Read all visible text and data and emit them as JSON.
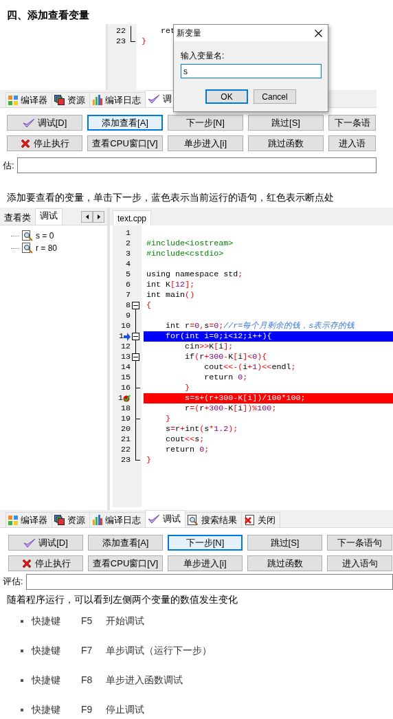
{
  "heading": "四、添加查看变量",
  "shot1": {
    "editor": {
      "lines": [
        {
          "number": "22",
          "code": "    ret",
          "kind": "guide",
          "current": false,
          "breakpoint": false
        },
        {
          "number": "23",
          "code": "}",
          "kind": "last",
          "current": false,
          "breakpoint": false
        }
      ]
    },
    "dialog": {
      "title": "新变量",
      "label": "输入变量名:",
      "value": "s",
      "buttons": [
        {
          "label": "OK",
          "default": true
        },
        {
          "label": "Cancel",
          "default": false
        }
      ]
    },
    "tabs": [
      {
        "label": "编译器",
        "kind": "grid",
        "selected": false
      },
      {
        "label": "资源",
        "kind": "squares",
        "selected": false
      },
      {
        "label": "编译日志",
        "kind": "bars",
        "selected": false
      },
      {
        "label": "调",
        "kind": "check",
        "selected": true
      }
    ],
    "buttons": [
      {
        "label": "调试[D]",
        "kind": "check",
        "focused": false
      },
      {
        "label": "添加查看[A]",
        "kind": "plain",
        "focused": true
      },
      {
        "label": "下一步[N]",
        "kind": "plain",
        "focused": false
      },
      {
        "label": "跳过[S]",
        "kind": "plain",
        "focused": false
      },
      {
        "label": "下一条语",
        "kind": "plain",
        "focused": false
      },
      {
        "label": "停止执行",
        "kind": "cross",
        "focused": false
      },
      {
        "label": "查看CPU窗口[V]",
        "kind": "plain",
        "focused": false
      },
      {
        "label": "单步进入[i]",
        "kind": "plain",
        "focused": false
      },
      {
        "label": "跳过函数",
        "kind": "plain",
        "focused": false
      },
      {
        "label": "进入语",
        "kind": "plain",
        "focused": false
      }
    ],
    "eval_label": "估:"
  },
  "caption_1": "添加要查看的变量，单击下一步，蓝色表示当前运行的语句，红色表示断点处",
  "shot2": {
    "side_tabs": [
      {
        "label": "查看类",
        "selected": false
      },
      {
        "label": "调试",
        "selected": true
      }
    ],
    "watches": [
      {
        "text": "s = 0"
      },
      {
        "text": "r = 80"
      }
    ],
    "editor": {
      "file_tab": "text.cpp",
      "lines": [
        {
          "number": "1",
          "kind": "plain",
          "current": false,
          "breakpoint": false
        },
        {
          "number": "2",
          "code": "#include<iostream>",
          "kind": "plain",
          "current": false,
          "breakpoint": false
        },
        {
          "number": "3",
          "code": "#include<cstdio>",
          "kind": "plain",
          "current": false,
          "breakpoint": false
        },
        {
          "number": "4",
          "kind": "plain",
          "current": false,
          "breakpoint": false
        },
        {
          "number": "5",
          "code": "using namespace std;",
          "kind": "plain",
          "current": false,
          "breakpoint": false
        },
        {
          "number": "6",
          "code": "int K[12];",
          "kind": "plain",
          "current": false,
          "breakpoint": false
        },
        {
          "number": "7",
          "code": "int main()",
          "kind": "plain",
          "current": false,
          "breakpoint": false
        },
        {
          "number": "8",
          "code": "{",
          "kind": "collapse",
          "current": false,
          "breakpoint": false
        },
        {
          "number": "9",
          "kind": "guide",
          "current": false,
          "breakpoint": false
        },
        {
          "number": "10",
          "code": "    int r=0,s=0;//r=每个月剩余的钱，s表示存的钱",
          "kind": "guide",
          "current": false,
          "breakpoint": false
        },
        {
          "number": "1",
          "code": "    for(int i=0;i<12;i++){",
          "kind": "collapse",
          "current": true,
          "breakpoint": false
        },
        {
          "number": "12",
          "code": "        cin>>K[i];",
          "kind": "guide",
          "current": false,
          "breakpoint": false
        },
        {
          "number": "13",
          "code": "        if(r+300-K[i]<0){",
          "kind": "collapse",
          "current": false,
          "breakpoint": false
        },
        {
          "number": "14",
          "code": "            cout<<-(i+1)<<endl;",
          "kind": "guide",
          "current": false,
          "breakpoint": false
        },
        {
          "number": "15",
          "code": "            return 0;",
          "kind": "guide",
          "current": false,
          "breakpoint": false
        },
        {
          "number": "16",
          "code": "        }",
          "kind": "end",
          "current": false,
          "breakpoint": false
        },
        {
          "number": "1",
          "code": "        s=s+(r+300-K[i])/100*100;",
          "kind": "guide",
          "current": false,
          "breakpoint": true
        },
        {
          "number": "18",
          "code": "        r=(r+300-K[i])%100;",
          "kind": "guide",
          "current": false,
          "breakpoint": false
        },
        {
          "number": "19",
          "code": "    }",
          "kind": "end",
          "current": false,
          "breakpoint": false
        },
        {
          "number": "20",
          "code": "    s=r+int(s*1.2);",
          "kind": "guide",
          "current": false,
          "breakpoint": false
        },
        {
          "number": "21",
          "code": "    cout<<s;",
          "kind": "guide",
          "current": false,
          "breakpoint": false
        },
        {
          "number": "22",
          "code": "    return 0;",
          "kind": "guide",
          "current": false,
          "breakpoint": false
        },
        {
          "number": "23",
          "code": "}",
          "kind": "last",
          "current": false,
          "breakpoint": false
        }
      ]
    },
    "tabs": [
      {
        "label": "编译器",
        "kind": "grid",
        "selected": false
      },
      {
        "label": "资源",
        "kind": "squares",
        "selected": false
      },
      {
        "label": "编译日志",
        "kind": "bars",
        "selected": false
      },
      {
        "label": "调试",
        "kind": "check",
        "selected": true
      },
      {
        "label": "搜索结果",
        "kind": "search",
        "selected": false
      },
      {
        "label": "关闭",
        "kind": "close",
        "selected": false
      }
    ],
    "buttons": [
      {
        "label": "调试[D]",
        "kind": "check",
        "focused": false
      },
      {
        "label": "添加查看[A]",
        "kind": "plain",
        "focused": false
      },
      {
        "label": "下一步[N]",
        "kind": "plain",
        "focused": true
      },
      {
        "label": "跳过[S]",
        "kind": "plain",
        "focused": false
      },
      {
        "label": "下一条语句",
        "kind": "plain",
        "focused": false
      },
      {
        "label": "停止执行",
        "kind": "cross",
        "focused": false
      },
      {
        "label": "查看CPU窗口[V]",
        "kind": "plain",
        "focused": false
      },
      {
        "label": "单步进入[i]",
        "kind": "plain",
        "focused": false
      },
      {
        "label": "跳过函数",
        "kind": "plain",
        "focused": false
      },
      {
        "label": "进入语句",
        "kind": "plain",
        "focused": false
      }
    ],
    "eval_label": "评估:"
  },
  "caption_2": "随着程序运行，可以看到左侧两个变量的数值发生变化",
  "shortcuts": [
    {
      "key": "快捷键",
      "shortcut": "F5",
      "action": "开始调试"
    },
    {
      "key": "快捷键",
      "shortcut": "F7",
      "action": "单步调试（运行下一步）"
    },
    {
      "key": "快捷键",
      "shortcut": "F8",
      "action": "单步进入函数调试"
    },
    {
      "key": "快捷键",
      "shortcut": "F9",
      "action": "停止调试"
    }
  ]
}
